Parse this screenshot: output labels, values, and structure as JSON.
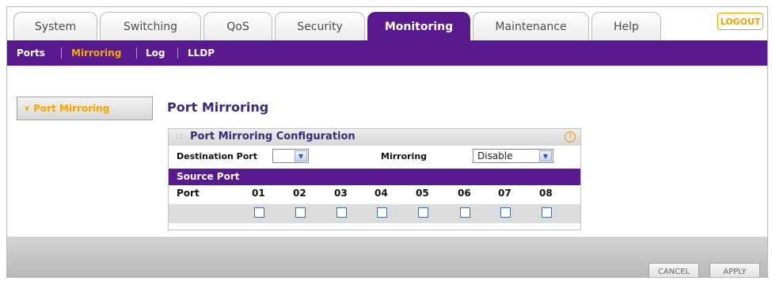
{
  "tabs": [
    {
      "label": "System"
    },
    {
      "label": "Switching"
    },
    {
      "label": "QoS"
    },
    {
      "label": "Security"
    },
    {
      "label": "Monitoring"
    },
    {
      "label": "Maintenance"
    },
    {
      "label": "Help"
    }
  ],
  "active_tab": "Monitoring",
  "logout_label": "LOGOUT",
  "subnav": [
    {
      "label": "Ports"
    },
    {
      "label": "Mirroring"
    },
    {
      "label": "Log"
    },
    {
      "label": "LLDP"
    }
  ],
  "active_subnav": "Mirroring",
  "sidebar": {
    "item_label": "Port Mirroring"
  },
  "page_title": "Port Mirroring",
  "panel": {
    "title": "Port Mirroring Configuration",
    "help_icon": "?",
    "destination_label": "Destination Port",
    "destination_value": "",
    "mirroring_label": "Mirroring",
    "mirroring_value": "Disable",
    "source_port_label": "Source Port",
    "port_label": "Port",
    "ports": [
      "01",
      "02",
      "03",
      "04",
      "05",
      "06",
      "07",
      "08"
    ],
    "checked": [
      false,
      false,
      false,
      false,
      false,
      false,
      false,
      false
    ]
  },
  "footer": {
    "cancel_label": "CANCEL",
    "apply_label": "APPLY"
  },
  "colors": {
    "brand_purple": "#5a1a8f",
    "accent_orange": "#f5a400"
  }
}
